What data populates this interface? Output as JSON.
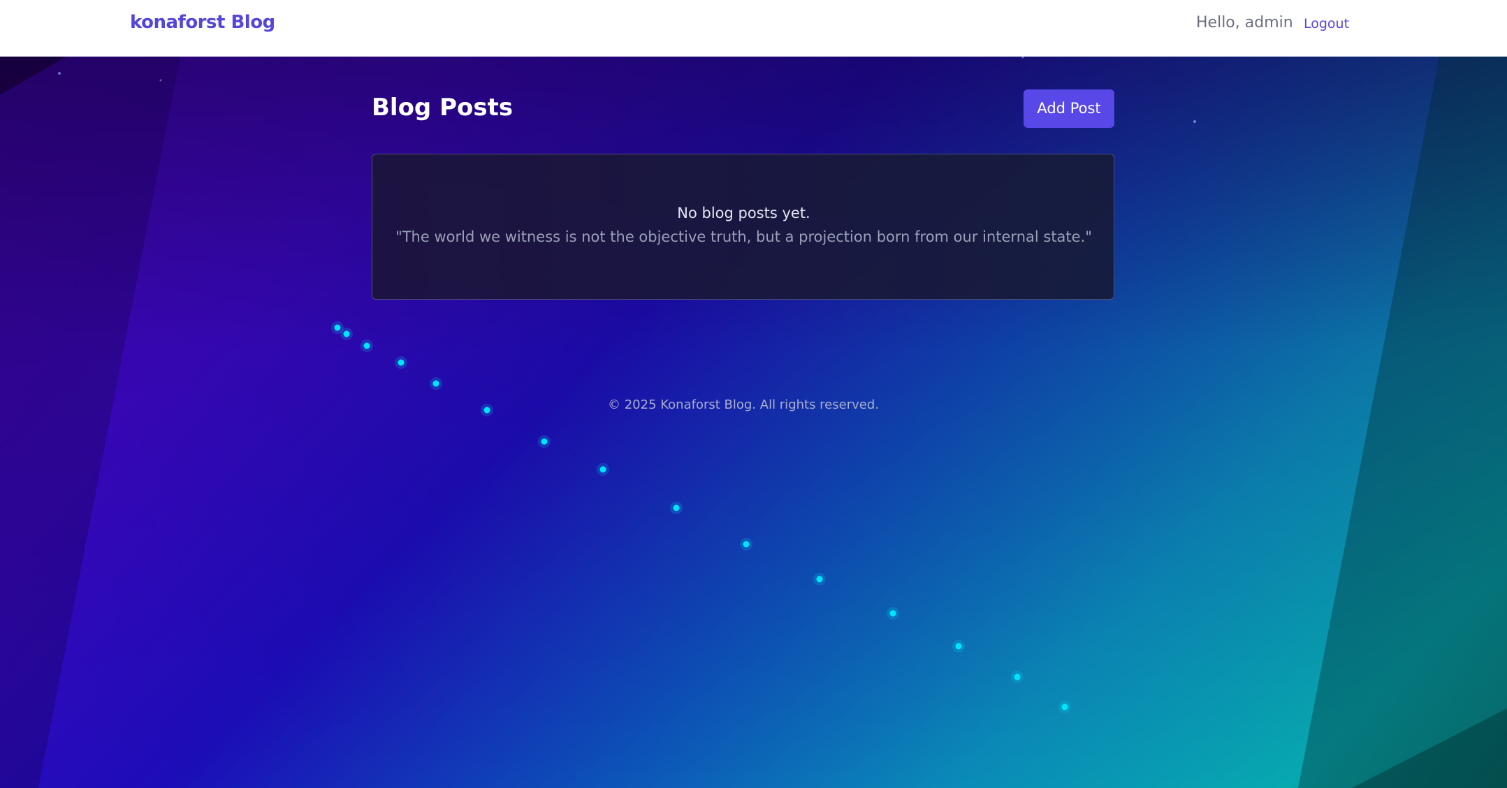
{
  "navbar": {
    "brand": "konaforst Blog",
    "greeting": "Hello, admin",
    "logout_label": "Logout"
  },
  "main": {
    "title": "Blog Posts",
    "add_button_label": "Add Post",
    "empty_state": {
      "title": "No blog posts yet.",
      "quote": "\"The world we witness is not the objective truth, but a projection born from our internal state.\""
    }
  },
  "footer": {
    "text": "© 2025 Konaforst Blog. All rights reserved."
  },
  "colors": {
    "accent": "#5446d8",
    "button": "#5848e8",
    "dot": "#00e5ff"
  }
}
